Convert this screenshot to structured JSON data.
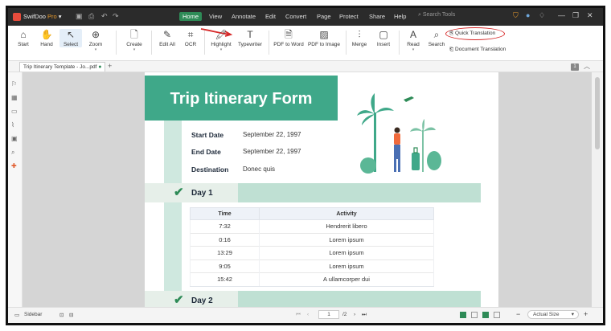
{
  "app": {
    "name": "SwifDoo",
    "edition": "Pro",
    "edition_caret": "▾"
  },
  "menu": {
    "items": [
      "Home",
      "View",
      "Annotate",
      "Edit",
      "Convert",
      "Page",
      "Protect",
      "Share",
      "Help"
    ],
    "search_placeholder": "Search Tools"
  },
  "ribbon": {
    "start": "Start",
    "hand": "Hand",
    "select": "Select",
    "zoom": "Zoom",
    "create": "Create",
    "edit_all": "Edit All",
    "ocr": "OCR",
    "highlight": "Highlight",
    "typewriter": "Typewriter",
    "pdf_to_word": "PDF to Word",
    "pdf_to_image": "PDF to Image",
    "merge": "Merge",
    "insert": "Insert",
    "read": "Read",
    "search": "Search",
    "quick_translation": "Quick Translation",
    "document_translation": "Document Translation"
  },
  "tabs": {
    "doc_tab": "Trip Itinerary Template - Jo...pdf",
    "doc_modified_dot": "●",
    "new_tab": "+",
    "page_badge": "1"
  },
  "document": {
    "title": "Trip Itinerary Form",
    "fields": [
      {
        "label": "Start Date",
        "value": "September 22, 1997"
      },
      {
        "label": "End Date",
        "value": "September 22, 1997"
      },
      {
        "label": "Destination",
        "value": "Donec quis"
      }
    ],
    "day1": "Day 1",
    "day2": "Day 2",
    "table": {
      "headers": [
        "Time",
        "Activity"
      ],
      "rows": [
        [
          "7:32",
          "Hendrerit libero"
        ],
        [
          "0:16",
          "Lorem ipsum"
        ],
        [
          "13:29",
          "Lorem ipsum"
        ],
        [
          "9:05",
          "Lorem ipsum"
        ],
        [
          "15:42",
          "A ullamcorper dui"
        ]
      ]
    }
  },
  "status": {
    "sidebar": "Sidebar",
    "current_page": "1",
    "total_pages": "/2",
    "zoom_level": "Actual Size",
    "zoom_minus": "−",
    "zoom_plus": "+"
  },
  "colors": {
    "accent": "#2e8b57",
    "header_green": "#3fa889",
    "annotation_red": "#d62828"
  }
}
